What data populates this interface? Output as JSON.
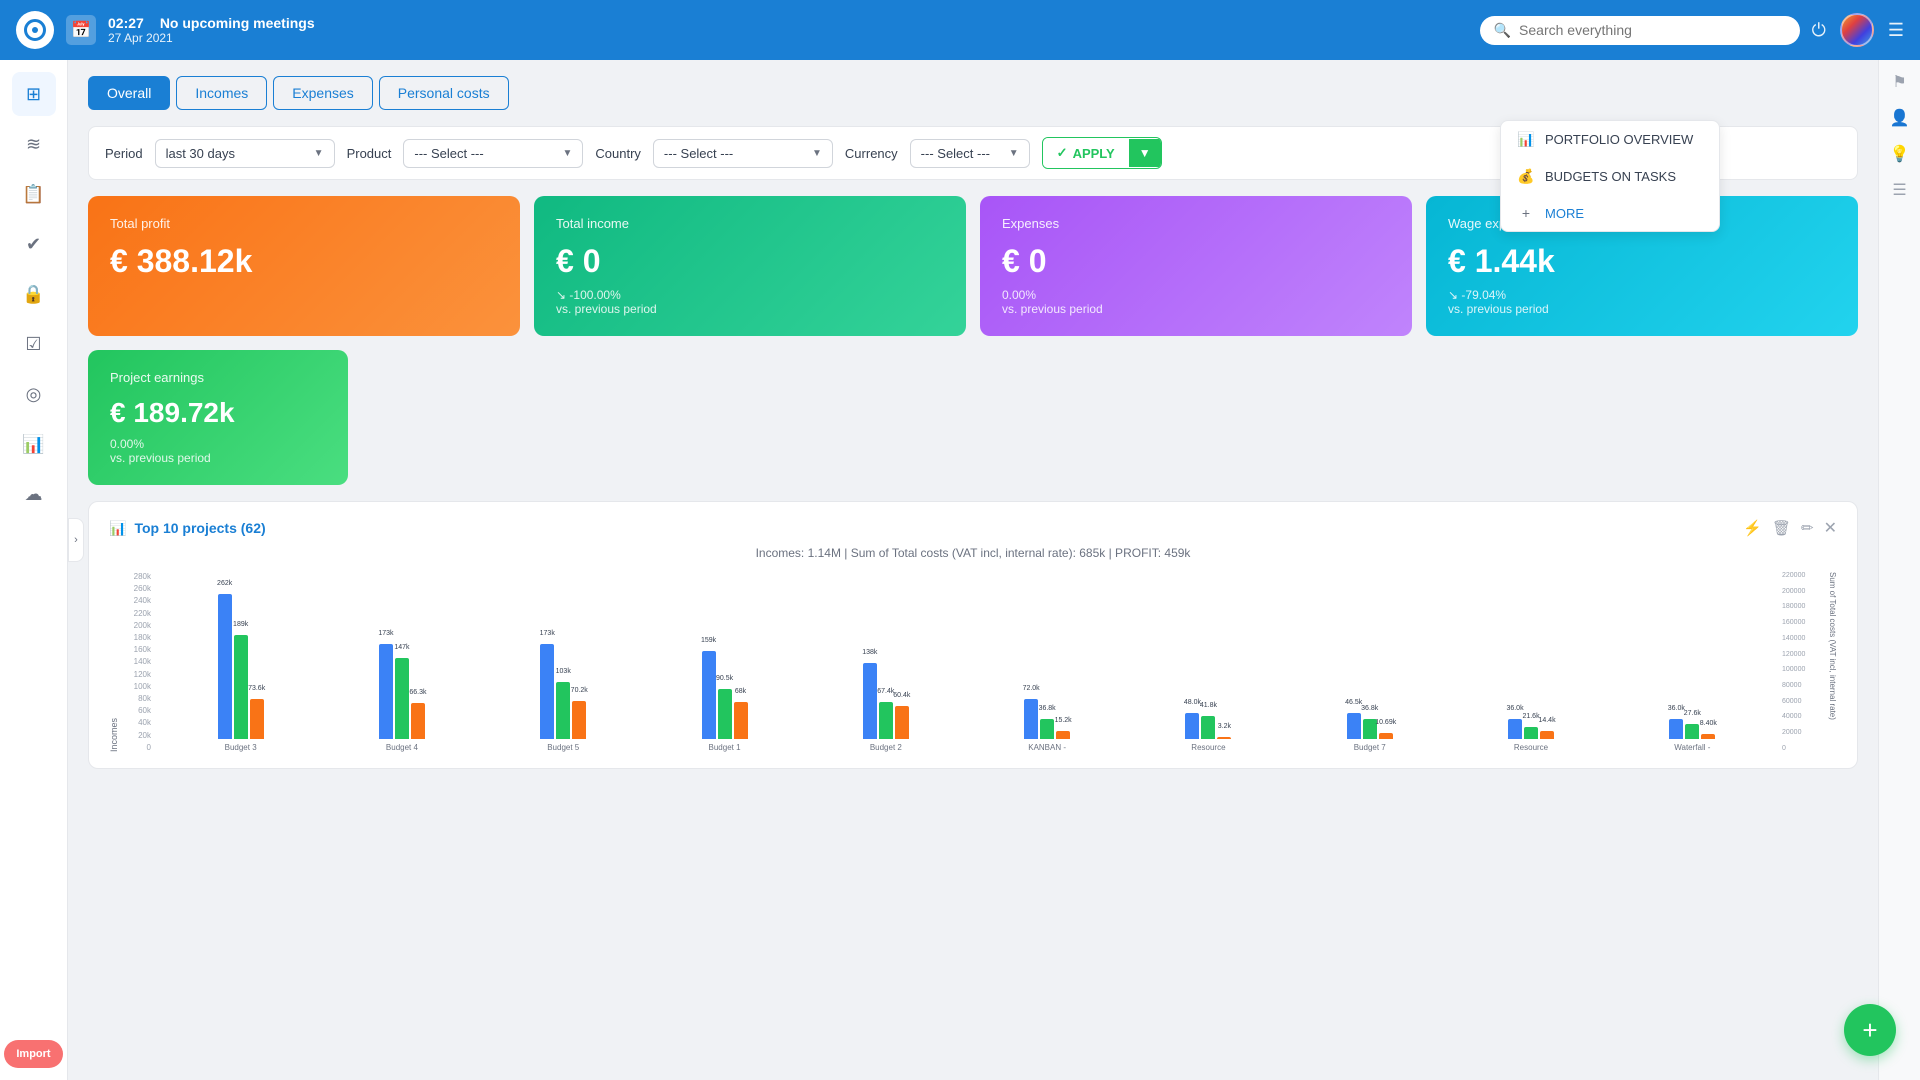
{
  "app": {
    "logo_alt": "Teamwork logo"
  },
  "topnav": {
    "time": "02:27",
    "meeting": "No upcoming meetings",
    "date": "27 Apr 2021",
    "search_placeholder": "Search everything"
  },
  "sidebar": {
    "items": [
      {
        "id": "grid",
        "icon": "⊞",
        "label": "Dashboard"
      },
      {
        "id": "list",
        "icon": "≡",
        "label": "List"
      },
      {
        "id": "tasks",
        "icon": "📋",
        "label": "Tasks"
      },
      {
        "id": "checklist",
        "icon": "✔",
        "label": "Checklist"
      },
      {
        "id": "lock",
        "icon": "🔒",
        "label": "Lock"
      },
      {
        "id": "check",
        "icon": "☑",
        "label": "Check"
      },
      {
        "id": "target",
        "icon": "◎",
        "label": "Target"
      },
      {
        "id": "chart",
        "icon": "📊",
        "label": "Chart"
      },
      {
        "id": "cloud",
        "icon": "☁",
        "label": "Cloud"
      }
    ],
    "import_label": "Import"
  },
  "right_sidebar": {
    "items": [
      {
        "id": "flag",
        "icon": "⚑"
      },
      {
        "id": "user-search",
        "icon": "👤"
      },
      {
        "id": "bulb",
        "icon": "💡"
      },
      {
        "id": "tasks-list",
        "icon": "☰"
      }
    ]
  },
  "tabs": [
    {
      "id": "overall",
      "label": "Overall",
      "active": true
    },
    {
      "id": "incomes",
      "label": "Incomes",
      "active": false
    },
    {
      "id": "expenses",
      "label": "Expenses",
      "active": false
    },
    {
      "id": "personal",
      "label": "Personal costs",
      "active": false
    }
  ],
  "filters": {
    "period_label": "Period",
    "period_value": "last 30 days",
    "product_label": "Product",
    "product_placeholder": "--- Select ---",
    "country_label": "Country",
    "country_placeholder": "--- Select ---",
    "currency_label": "Currency",
    "currency_placeholder": "--- Select ---",
    "apply_label": "APPLY"
  },
  "stat_cards": [
    {
      "id": "profit",
      "title": "Total profit",
      "value": "€ 388.12k",
      "change": "",
      "change_label": "",
      "color": "profit"
    },
    {
      "id": "income",
      "title": "Total income",
      "value": "€ 0",
      "change": "-100.00%",
      "change_label": "vs. previous period",
      "color": "income"
    },
    {
      "id": "expenses",
      "title": "Expenses",
      "value": "€ 0",
      "change": "0.00%",
      "change_label": "vs. previous period",
      "color": "expenses"
    },
    {
      "id": "wage",
      "title": "Wage expenses",
      "value": "€ 1.44k",
      "change": "-79.04%",
      "change_label": "vs. previous period",
      "color": "wage"
    }
  ],
  "earnings_card": {
    "title": "Project earnings",
    "value": "€ 189.72k",
    "change": "0.00%",
    "change_label": "vs. previous period"
  },
  "chart": {
    "title": "Top 10 projects (62)",
    "subtitle": "Incomes: 1.14M | Sum of Total costs (VAT incl, internal rate): 685k | PROFIT: 459k",
    "y_axis_label": "Incomes",
    "y_axis_right_label": "Sum of Total costs (VAT incl, internal rate)",
    "y_left": [
      "280k",
      "260k",
      "240k",
      "220k",
      "200k",
      "180k",
      "160k",
      "140k",
      "120k",
      "100k",
      "80k",
      "60k",
      "40k",
      "20k",
      "0"
    ],
    "y_right": [
      "220000",
      "200000",
      "180000",
      "160000",
      "140000",
      "120000",
      "100000",
      "80000",
      "60000",
      "40000",
      "20000",
      "0"
    ],
    "bars": [
      {
        "label": "Budget 3",
        "blue": 262,
        "green": 189,
        "orange": 73.6,
        "blue_label": "262k",
        "green_label": "189k",
        "orange_label": "73.6k",
        "height_blue": 145,
        "height_green": 104,
        "height_orange": 40
      },
      {
        "label": "Budget 4",
        "blue": 173,
        "green": 147,
        "orange": 66.3,
        "blue_label": "173k",
        "green_label": "147k",
        "orange_label": "66.3k",
        "height_blue": 95,
        "height_green": 81,
        "height_orange": 36
      },
      {
        "label": "Budget 5",
        "blue": 173,
        "green": 103,
        "orange": 70.2,
        "blue_label": "173k",
        "green_label": "103k",
        "orange_label": "70.2k",
        "height_blue": 95,
        "height_green": 57,
        "height_orange": 38
      },
      {
        "label": "Budget 1",
        "blue": 159,
        "green": 90.5,
        "orange": 68,
        "blue_label": "159k",
        "green_label": "90.5k",
        "orange_label": "68k",
        "height_blue": 88,
        "height_green": 50,
        "height_orange": 37
      },
      {
        "label": "Budget 2",
        "blue": 138,
        "green": 67.4,
        "orange": 60.4,
        "blue_label": "138k",
        "green_label": "67.4k",
        "orange_label": "60.4k",
        "height_blue": 76,
        "height_green": 37,
        "height_orange": 33
      },
      {
        "label": "KANBAN -",
        "blue": 72,
        "green": 36.8,
        "orange": 15.2,
        "blue_label": "72.0k",
        "green_label": "36.8k",
        "orange_label": "15.2k",
        "height_blue": 40,
        "height_green": 20,
        "height_orange": 8
      },
      {
        "label": "Resource",
        "blue": 48,
        "green": 41.8,
        "orange": 3.2,
        "blue_label": "48.0k",
        "green_label": "41.8k",
        "orange_label": "3.2k",
        "height_blue": 26,
        "height_green": 23,
        "height_orange": 2
      },
      {
        "label": "Budget 7",
        "blue": 46.5,
        "green": 36.8,
        "orange": 10.69,
        "blue_label": "46.5k",
        "green_label": "36.8k",
        "orange_label": "10.69k",
        "height_blue": 26,
        "height_green": 20,
        "height_orange": 6
      },
      {
        "label": "Resource",
        "blue": 36,
        "green": 21.6,
        "orange": 14.4,
        "blue_label": "36.0k",
        "green_label": "21.6k",
        "orange_label": "14.4k",
        "height_blue": 20,
        "height_green": 12,
        "height_orange": 8
      },
      {
        "label": "Waterfall -",
        "blue": 36,
        "green": 27.6,
        "orange": 8.4,
        "blue_label": "36.0k",
        "green_label": "27.6k",
        "orange_label": "8.40k",
        "height_blue": 20,
        "height_green": 15,
        "height_orange": 5
      }
    ]
  },
  "dropdown": {
    "items": [
      {
        "icon": "📊",
        "label": "PORTFOLIO OVERVIEW"
      },
      {
        "icon": "💰",
        "label": "BUDGETS ON TASKS"
      },
      {
        "icon": "+",
        "label": "MORE"
      }
    ]
  },
  "fab": {
    "label": "+"
  }
}
